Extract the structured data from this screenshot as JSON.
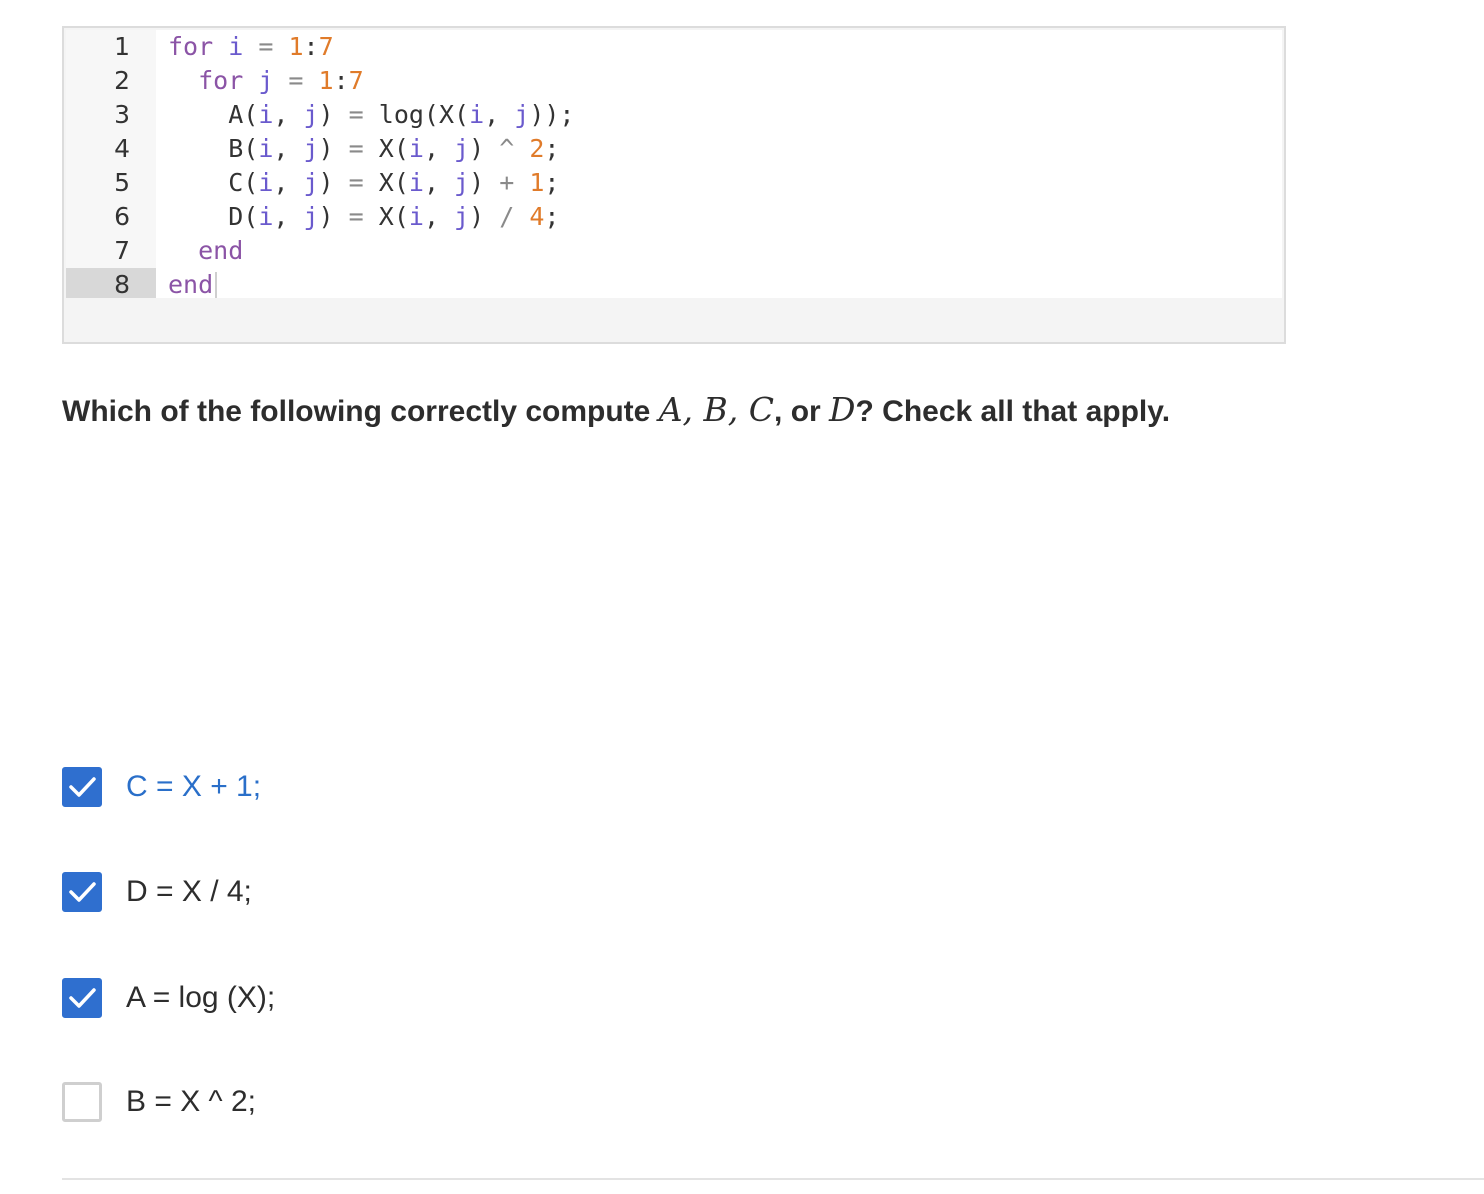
{
  "code": {
    "lines": [
      {
        "num": "1",
        "segments": [
          {
            "t": "for",
            "c": "#8b54a6"
          },
          {
            "t": " i ",
            "c": "#6a5acd"
          },
          {
            "t": "=",
            "c": "#8a8a8a"
          },
          {
            "t": " ",
            "c": "#333333"
          },
          {
            "t": "1",
            "c": "#e07b2a"
          },
          {
            "t": ":",
            "c": "#333333"
          },
          {
            "t": "7",
            "c": "#e07b2a"
          }
        ]
      },
      {
        "num": "2",
        "segments": [
          {
            "t": "  for",
            "c": "#8b54a6"
          },
          {
            "t": " j ",
            "c": "#6a5acd"
          },
          {
            "t": "=",
            "c": "#8a8a8a"
          },
          {
            "t": " ",
            "c": "#333333"
          },
          {
            "t": "1",
            "c": "#e07b2a"
          },
          {
            "t": ":",
            "c": "#333333"
          },
          {
            "t": "7",
            "c": "#e07b2a"
          }
        ]
      },
      {
        "num": "3",
        "segments": [
          {
            "t": "    A(",
            "c": "#333333"
          },
          {
            "t": "i",
            "c": "#6a5acd"
          },
          {
            "t": ", ",
            "c": "#333333"
          },
          {
            "t": "j",
            "c": "#6a5acd"
          },
          {
            "t": ") ",
            "c": "#333333"
          },
          {
            "t": "=",
            "c": "#8a8a8a"
          },
          {
            "t": " log(X(",
            "c": "#333333"
          },
          {
            "t": "i",
            "c": "#6a5acd"
          },
          {
            "t": ", ",
            "c": "#333333"
          },
          {
            "t": "j",
            "c": "#6a5acd"
          },
          {
            "t": "));",
            "c": "#333333"
          }
        ]
      },
      {
        "num": "4",
        "segments": [
          {
            "t": "    B(",
            "c": "#333333"
          },
          {
            "t": "i",
            "c": "#6a5acd"
          },
          {
            "t": ", ",
            "c": "#333333"
          },
          {
            "t": "j",
            "c": "#6a5acd"
          },
          {
            "t": ") ",
            "c": "#333333"
          },
          {
            "t": "=",
            "c": "#8a8a8a"
          },
          {
            "t": " X(",
            "c": "#333333"
          },
          {
            "t": "i",
            "c": "#6a5acd"
          },
          {
            "t": ", ",
            "c": "#333333"
          },
          {
            "t": "j",
            "c": "#6a5acd"
          },
          {
            "t": ") ",
            "c": "#333333"
          },
          {
            "t": "^",
            "c": "#8a8a8a"
          },
          {
            "t": " ",
            "c": "#333333"
          },
          {
            "t": "2",
            "c": "#e07b2a"
          },
          {
            "t": ";",
            "c": "#333333"
          }
        ]
      },
      {
        "num": "5",
        "segments": [
          {
            "t": "    C(",
            "c": "#333333"
          },
          {
            "t": "i",
            "c": "#6a5acd"
          },
          {
            "t": ", ",
            "c": "#333333"
          },
          {
            "t": "j",
            "c": "#6a5acd"
          },
          {
            "t": ") ",
            "c": "#333333"
          },
          {
            "t": "=",
            "c": "#8a8a8a"
          },
          {
            "t": " X(",
            "c": "#333333"
          },
          {
            "t": "i",
            "c": "#6a5acd"
          },
          {
            "t": ", ",
            "c": "#333333"
          },
          {
            "t": "j",
            "c": "#6a5acd"
          },
          {
            "t": ") ",
            "c": "#333333"
          },
          {
            "t": "+",
            "c": "#8a8a8a"
          },
          {
            "t": " ",
            "c": "#333333"
          },
          {
            "t": "1",
            "c": "#e07b2a"
          },
          {
            "t": ";",
            "c": "#333333"
          }
        ]
      },
      {
        "num": "6",
        "segments": [
          {
            "t": "    D(",
            "c": "#333333"
          },
          {
            "t": "i",
            "c": "#6a5acd"
          },
          {
            "t": ", ",
            "c": "#333333"
          },
          {
            "t": "j",
            "c": "#6a5acd"
          },
          {
            "t": ") ",
            "c": "#333333"
          },
          {
            "t": "=",
            "c": "#8a8a8a"
          },
          {
            "t": " X(",
            "c": "#333333"
          },
          {
            "t": "i",
            "c": "#6a5acd"
          },
          {
            "t": ", ",
            "c": "#333333"
          },
          {
            "t": "j",
            "c": "#6a5acd"
          },
          {
            "t": ") ",
            "c": "#333333"
          },
          {
            "t": "/",
            "c": "#8a8a8a"
          },
          {
            "t": " ",
            "c": "#333333"
          },
          {
            "t": "4",
            "c": "#e07b2a"
          },
          {
            "t": ";",
            "c": "#333333"
          }
        ]
      },
      {
        "num": "7",
        "segments": [
          {
            "t": "  end",
            "c": "#8b54a6"
          }
        ]
      },
      {
        "num": "8",
        "segments": [
          {
            "t": "end",
            "c": "#8b54a6"
          }
        ],
        "active": true
      }
    ]
  },
  "question": {
    "prefix": "Which of the following correctly compute ",
    "var_a": "A",
    "var_b": "B",
    "var_c": "C",
    "sep": ", ",
    "or_text": ", or ",
    "var_d": "D",
    "suffix": "? Check all that apply."
  },
  "options": [
    {
      "label": "C = X + 1;",
      "checked": true
    },
    {
      "label": "D = X / 4;",
      "checked": true
    },
    {
      "label": "A = log (X);",
      "checked": true
    },
    {
      "label": "B = X ^ 2;",
      "checked": false
    }
  ],
  "colors": {
    "checkbox_checked": "#2f6fcf",
    "checkbox_unchecked_border": "#cfcfcf",
    "option_hover_text": "#2a6fc9"
  }
}
